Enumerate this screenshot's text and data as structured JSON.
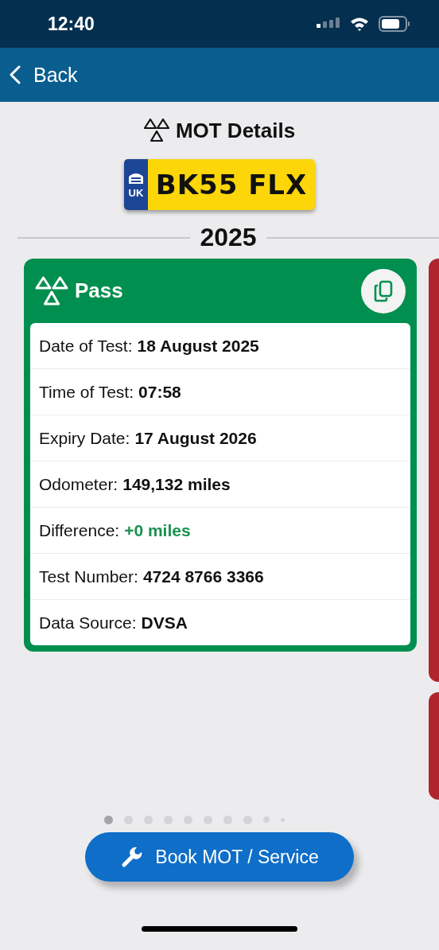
{
  "status_bar": {
    "time": "12:40"
  },
  "nav": {
    "back": "Back"
  },
  "header": {
    "title": "MOT Details",
    "plate": {
      "country": "UK",
      "registration": "BK55 FLX"
    }
  },
  "year": "2025",
  "card": {
    "result": "Pass",
    "color": "#008f4f",
    "rows": [
      {
        "label": "Date of Test:",
        "value": "18 August 2025",
        "kind": "plain"
      },
      {
        "label": "Time of Test:",
        "value": "07:58",
        "kind": "plain"
      },
      {
        "label": "Expiry Date:",
        "value": "17 August 2026",
        "kind": "plain"
      },
      {
        "label": "Odometer:",
        "value": "149,132 miles",
        "kind": "plain"
      },
      {
        "label": "Difference:",
        "value": "+0 miles",
        "kind": "change"
      },
      {
        "label": "Test Number:",
        "value": "4724 8766 3366",
        "kind": "plain"
      },
      {
        "label": "Data Source:",
        "value": "DVSA",
        "kind": "plain"
      }
    ]
  },
  "next_cards": [
    {
      "color": "#b0252d"
    },
    {
      "color": "#b0252d"
    }
  ],
  "pager": [
    {
      "selected": true,
      "kind": "full"
    },
    {
      "selected": false,
      "kind": "full"
    },
    {
      "selected": false,
      "kind": "full"
    },
    {
      "selected": false,
      "kind": "full"
    },
    {
      "selected": false,
      "kind": "full"
    },
    {
      "selected": false,
      "kind": "full"
    },
    {
      "selected": false,
      "kind": "full"
    },
    {
      "selected": false,
      "kind": "full"
    },
    {
      "selected": false,
      "kind": "small"
    },
    {
      "selected": false,
      "kind": "tiny"
    }
  ],
  "button": {
    "label": "Book MOT / Service"
  }
}
